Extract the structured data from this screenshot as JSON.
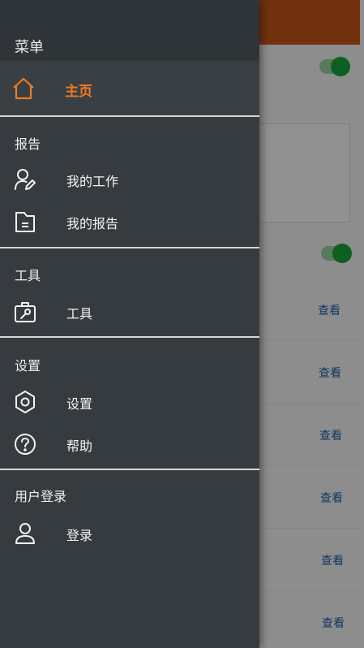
{
  "colors": {
    "accent": "#f07b1f",
    "header_bg": "#c7561a",
    "toggle_green": "#18a53a",
    "link_blue": "#1f5fa8",
    "drawer_bg": "#363b40"
  },
  "drawer": {
    "menu_title": "菜单",
    "home": {
      "label": "主页",
      "icon": "home-icon"
    },
    "sections": [
      {
        "title": "报告",
        "items": [
          {
            "label": "我的工作",
            "icon": "user-edit-icon"
          },
          {
            "label": "我的报告",
            "icon": "file-report-icon"
          }
        ]
      },
      {
        "title": "工具",
        "items": [
          {
            "label": "工具",
            "icon": "toolbox-icon"
          }
        ]
      },
      {
        "title": "设置",
        "items": [
          {
            "label": "设置",
            "icon": "settings-icon"
          },
          {
            "label": "帮助",
            "icon": "help-icon"
          }
        ]
      },
      {
        "title": "用户登录",
        "items": [
          {
            "label": "登录",
            "icon": "user-icon"
          }
        ]
      }
    ]
  },
  "background": {
    "links": [
      "查看",
      "查看",
      "查看",
      "查看",
      "查看",
      "查看"
    ]
  }
}
